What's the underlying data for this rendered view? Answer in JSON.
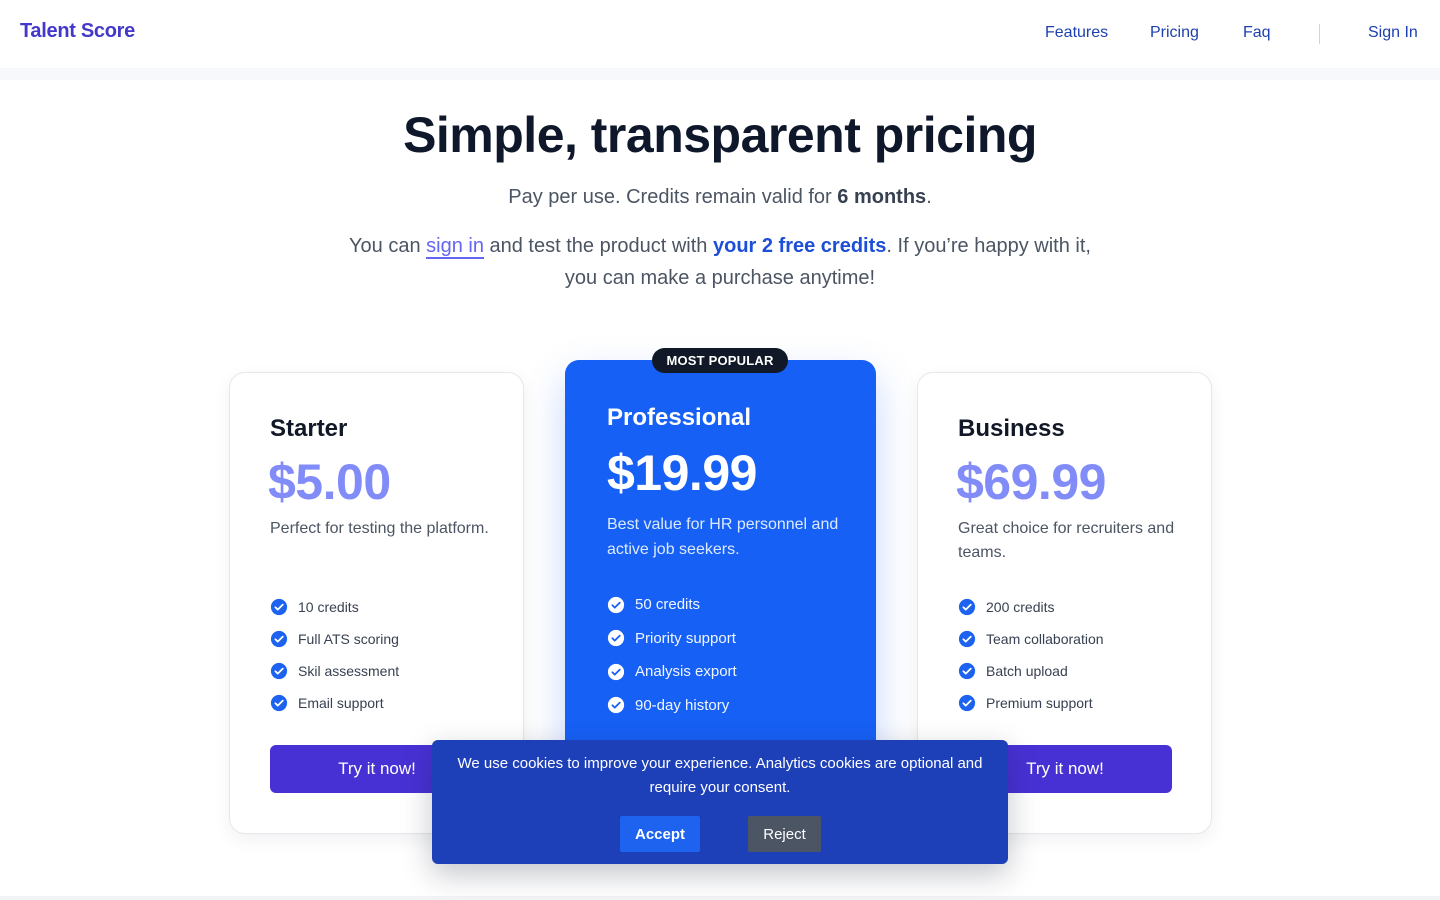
{
  "header": {
    "brand": "Talent Score",
    "nav": [
      {
        "label": "Features"
      },
      {
        "label": "Pricing"
      },
      {
        "label": "Faq"
      },
      {
        "label": "Sign In"
      }
    ]
  },
  "hero": {
    "title": "Simple, transparent pricing",
    "subtitle_prefix": "Pay per use. Credits remain valid for ",
    "subtitle_bold": "6 months",
    "subtitle_suffix": ".",
    "desc_prefix": "You can ",
    "desc_link": "sign in",
    "desc_middle": " and test the product with ",
    "desc_bold": "your 2 free credits",
    "desc_suffix": ". If you’re happy with it, you can make a purchase anytime!"
  },
  "plans": [
    {
      "name": "Starter",
      "price": "$5.00",
      "description": "Perfect for testing the platform.",
      "features": [
        "10 credits",
        "Full ATS scoring",
        "Skil assessment",
        "Email support"
      ],
      "cta": "Try it now!"
    },
    {
      "name": "Professional",
      "badge": "MOST POPULAR",
      "price": "$19.99",
      "description": "Best value for HR personnel and active job seekers.",
      "features": [
        "50 credits",
        "Priority support",
        "Analysis export",
        "90-day history"
      ]
    },
    {
      "name": "Business",
      "price": "$69.99",
      "description": "Great choice for recruiters and teams.",
      "features": [
        "200 credits",
        "Team collaboration",
        "Batch upload",
        "Premium support"
      ],
      "cta": "Try it now!"
    }
  ],
  "cookie": {
    "message": "We use cookies to improve your experience. Analytics cookies are optional and require your consent.",
    "accept": "Accept",
    "reject": "Reject"
  },
  "colors": {
    "brand": "#4338ca",
    "nav_link": "#1e40af",
    "pro_card": "#1760f5",
    "cta": "#4831d4",
    "side_price": "#818cf8",
    "cookie_bg": "#1d3fb8",
    "check": "#1d63f0"
  },
  "icons": {
    "feature_check": "check-circle-icon"
  }
}
